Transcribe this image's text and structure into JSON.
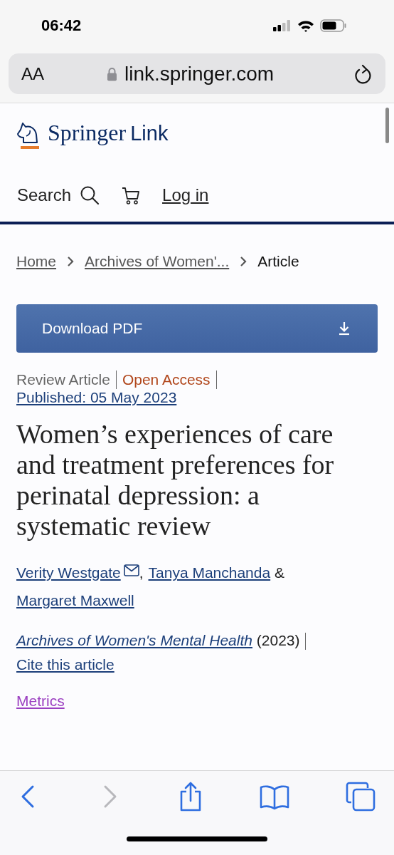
{
  "status_bar": {
    "time": "06:42"
  },
  "address_bar": {
    "text_size_button": "AA",
    "url": "link.springer.com"
  },
  "site_header": {
    "logo": {
      "wordmark": "Springer",
      "suffix": "Link"
    },
    "nav": [
      {
        "kind": "search",
        "label": "Search"
      },
      {
        "kind": "cart"
      },
      {
        "kind": "login",
        "label": "Log in"
      }
    ]
  },
  "breadcrumb": [
    {
      "label": "Home",
      "current": false
    },
    {
      "label": "Archives of Women'...",
      "current": false
    },
    {
      "label": "Article",
      "current": true
    }
  ],
  "download_button": {
    "label": "Download PDF"
  },
  "article_meta": {
    "type": "Review Article",
    "access": "Open Access",
    "published": "Published: 05 May 2023"
  },
  "title": "Women’s experiences of care and treatment preferences for perinatal depression: a systematic review",
  "authors": [
    {
      "name": "Verity Westgate",
      "email": true,
      "separator": ","
    },
    {
      "name": "Tanya Manchanda",
      "email": false,
      "separator": " &"
    },
    {
      "name": "Margaret Maxwell",
      "email": false
    }
  ],
  "citation": {
    "journal": "Archives of Women's Mental Health",
    "year": "(2023)",
    "cite_link": "Cite this article"
  },
  "metrics_link": {
    "label": "Metrics",
    "visited": true
  },
  "toolbar": [
    {
      "kind": "back",
      "disabled": false
    },
    {
      "kind": "forward",
      "disabled": true
    },
    {
      "kind": "share",
      "disabled": false
    },
    {
      "kind": "bookmarks",
      "disabled": false
    },
    {
      "kind": "tabs",
      "disabled": false
    }
  ]
}
